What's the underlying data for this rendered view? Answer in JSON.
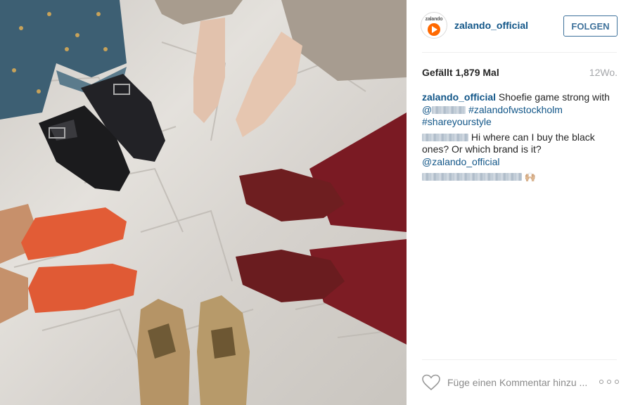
{
  "post": {
    "photo_icon": "shoes-photo",
    "alt_description": "Shoes of several people forming a circle on cobblestones"
  },
  "header": {
    "avatar_brand": "zalando",
    "username": "zalando_official",
    "follow_label": "FOLGEN"
  },
  "meta": {
    "likes": "Gefällt 1,879 Mal",
    "time": "12Wo."
  },
  "caption": {
    "user": "zalando_official",
    "text": "Shoefie game strong with",
    "mention_prefix": "@",
    "hashtag1": "#zalandofwstockholm",
    "hashtag2": "#shareyourstyle"
  },
  "comments": [
    {
      "text": "Hi where can I buy the black ones? Or which brand is it?",
      "mention": "@zalando_official"
    },
    {
      "emoji": "🙌🏼"
    }
  ],
  "footer": {
    "like_icon": "heart-outline-icon",
    "comment_placeholder": "Füge einen Kommentar hinzu ...",
    "more_icon": "more-options-icon"
  },
  "colors": {
    "link": "#125688",
    "follow": "#3f729b",
    "time": "#a5a7aa",
    "brand_orange": "#ff6900"
  }
}
